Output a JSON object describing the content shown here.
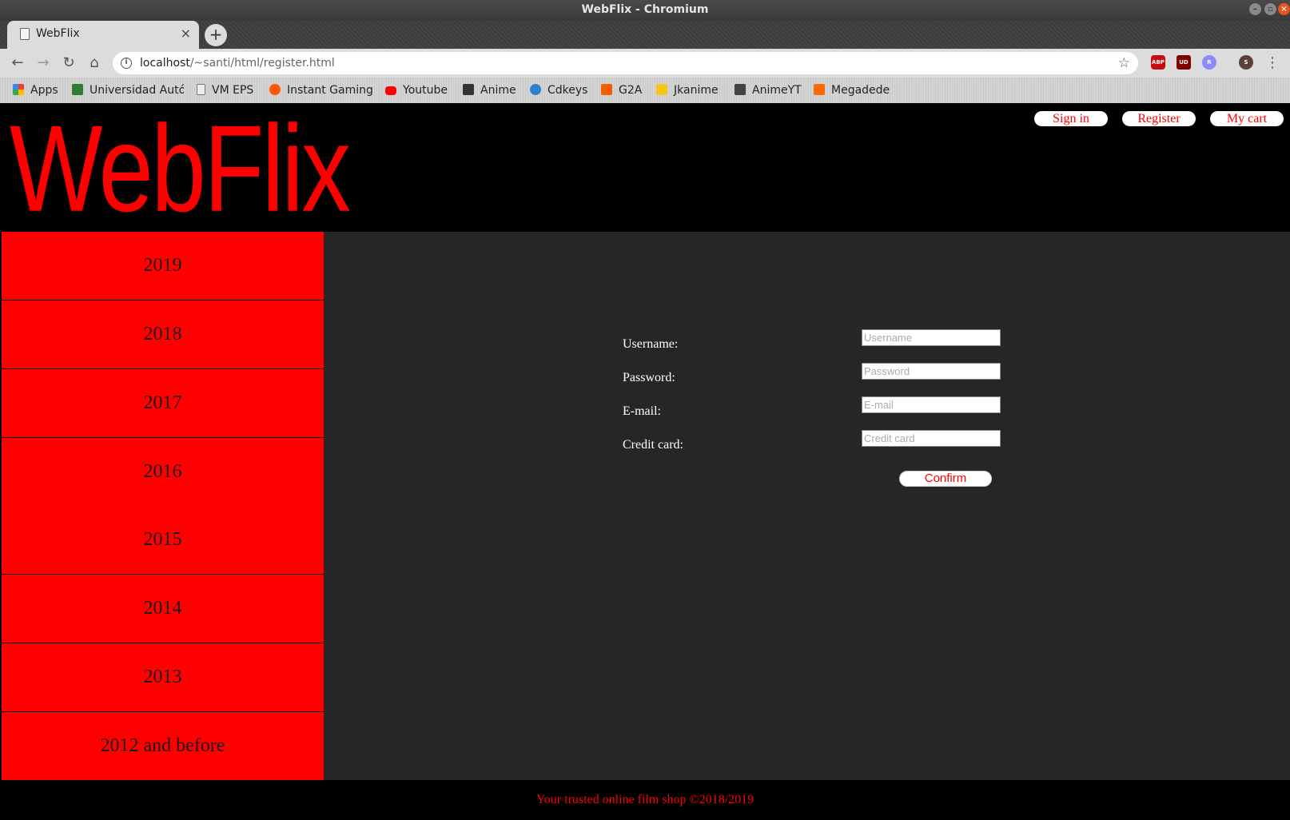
{
  "browser": {
    "window_title": "WebFlix - Chromium",
    "tab_title": "WebFlix",
    "url_host": "localhost",
    "url_path": "/~santi/html/register.html",
    "extensions": [
      "ABP",
      "UD",
      "R",
      "S"
    ],
    "bookmarks": [
      {
        "label": "Apps",
        "icon": "apps-grid-icon",
        "color": "#e94235"
      },
      {
        "label": "Universidad Autó",
        "icon": "university-icon",
        "color": "#2e7d32"
      },
      {
        "label": "VM EPS",
        "icon": "page-icon",
        "color": "#ffffff"
      },
      {
        "label": "Instant Gaming",
        "icon": "instant-gaming-icon",
        "color": "#ff5400"
      },
      {
        "label": "Youtube",
        "icon": "youtube-icon",
        "color": "#ff0000"
      },
      {
        "label": "Anime",
        "icon": "animeflv-icon",
        "color": "#333333"
      },
      {
        "label": "Cdkeys",
        "icon": "cdkeys-icon",
        "color": "#2f80d1"
      },
      {
        "label": "G2A",
        "icon": "g2a-icon",
        "color": "#f05f00"
      },
      {
        "label": "Jkanime",
        "icon": "jkanime-icon",
        "color": "#f5c518"
      },
      {
        "label": "AnimeYT",
        "icon": "animeyt-icon",
        "color": "#444444"
      },
      {
        "label": "Megadede",
        "icon": "megadede-icon",
        "color": "#ff6a00"
      }
    ]
  },
  "header": {
    "logo": "WebFlix",
    "nav": {
      "sign_in": "Sign in",
      "register": "Register",
      "cart": "My cart"
    }
  },
  "sidebar": {
    "years": [
      "2019",
      "2018",
      "2017",
      "2016",
      "2015",
      "2014",
      "2013",
      "2012 and before"
    ]
  },
  "form": {
    "username": {
      "label": "Username:",
      "placeholder": "Username"
    },
    "password": {
      "label": "Password:",
      "placeholder": "Password"
    },
    "email": {
      "label": "E-mail:",
      "placeholder": "E-mail"
    },
    "credit_card": {
      "label": "Credit card:",
      "placeholder": "Credit card"
    },
    "confirm_label": "Confirm"
  },
  "footer": {
    "text": "Your trusted online film shop ©2018/2019"
  },
  "colors": {
    "brand": "#ff0000",
    "content_bg": "#262626",
    "page_bg": "#000000"
  }
}
